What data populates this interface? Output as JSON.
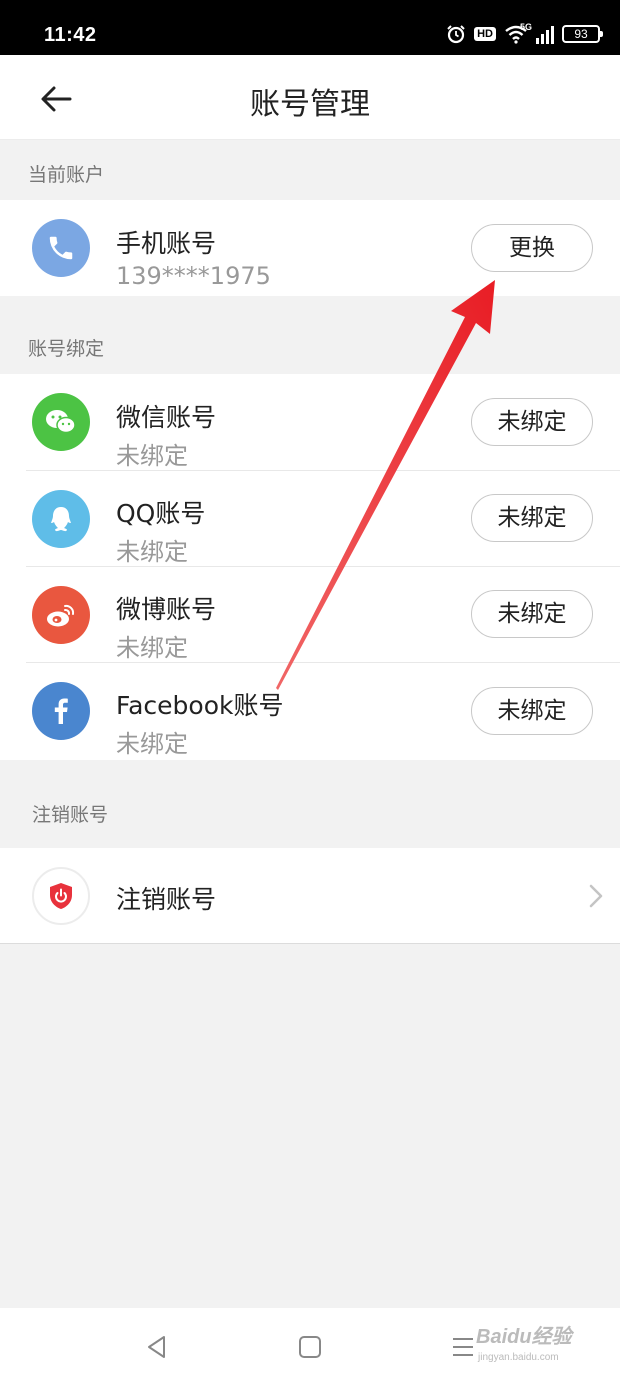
{
  "status_bar": {
    "time": "11:42",
    "hd_label": "HD",
    "network_label": "5G",
    "battery": "93"
  },
  "header": {
    "title": "账号管理",
    "back_icon": "back-arrow-icon"
  },
  "current_account": {
    "section_label": "当前账户",
    "item": {
      "title": "手机账号",
      "subtitle": "139****1975",
      "button": "更换",
      "icon": "phone-icon",
      "icon_color": "#7ba7e3"
    }
  },
  "bindings": {
    "section_label": "账号绑定",
    "items": [
      {
        "title": "微信账号",
        "subtitle": "未绑定",
        "button": "未绑定",
        "icon": "wechat-icon",
        "icon_color": "#4cc344"
      },
      {
        "title": "QQ账号",
        "subtitle": "未绑定",
        "button": "未绑定",
        "icon": "qq-icon",
        "icon_color": "#5fbde8"
      },
      {
        "title": "微博账号",
        "subtitle": "未绑定",
        "button": "未绑定",
        "icon": "weibo-icon",
        "icon_color": "#e9573f"
      },
      {
        "title": "Facebook账号",
        "subtitle": "未绑定",
        "button": "未绑定",
        "icon": "facebook-icon",
        "icon_color": "#4a86cf"
      }
    ]
  },
  "deactivate": {
    "section_label": "注销账号",
    "item": {
      "title": "注销账号",
      "icon": "power-shield-icon",
      "icon_color": "#e8323c"
    }
  },
  "nav_bar": {
    "back": "nav-back-icon",
    "home": "nav-home-icon",
    "menu": "nav-menu-icon"
  },
  "watermark": {
    "text": "Baidu经验",
    "sub": "jingyan.baidu.com"
  },
  "annotation": {
    "arrow_color": "#e8141c"
  }
}
